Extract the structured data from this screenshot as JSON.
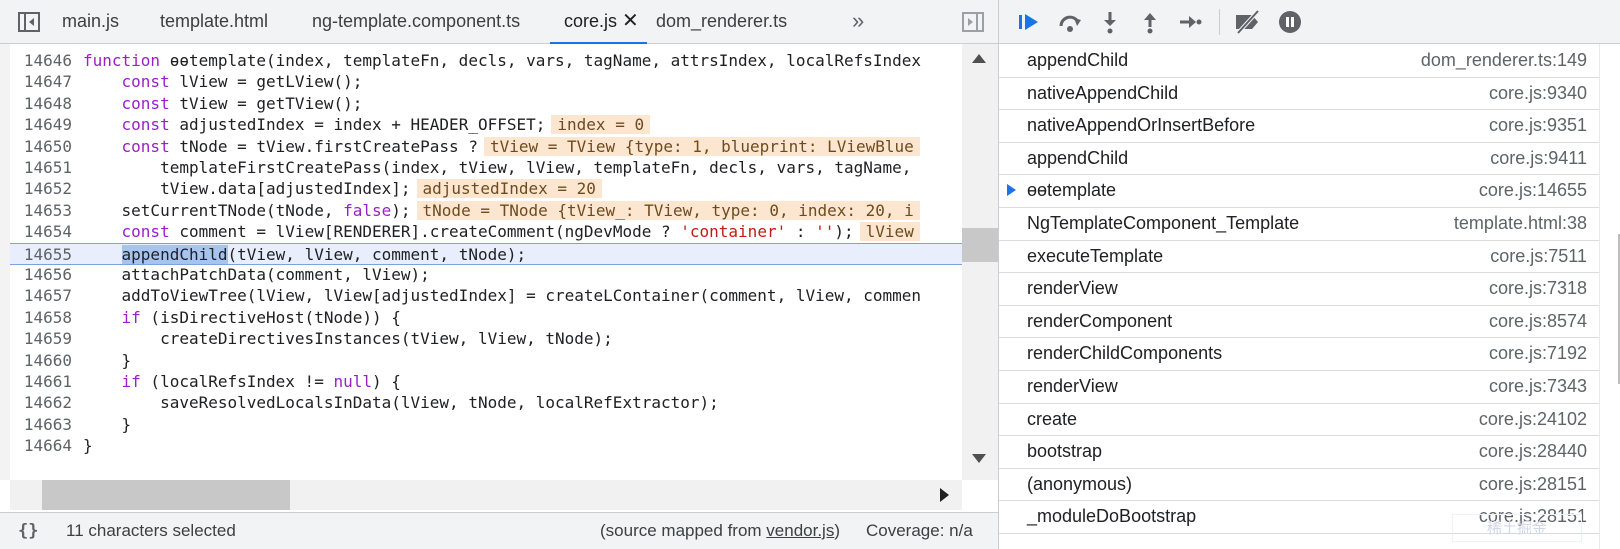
{
  "editor": {
    "tabs": [
      {
        "label": "main.js",
        "active": false
      },
      {
        "label": "template.html",
        "active": false
      },
      {
        "label": "ng-template.component.ts",
        "active": false
      },
      {
        "label": "core.js",
        "active": true
      },
      {
        "label": "dom_renderer.ts",
        "active": false
      }
    ],
    "tab_close_glyph": "✕",
    "more_tabs_glyph": "»",
    "current_line": 14655,
    "selected_text": "appendChild",
    "lines": [
      {
        "n": "14646",
        "code": "function ɵɵtemplate(index, templateFn, decls, vars, tagName, attrsIndex, localRefsIndex"
      },
      {
        "n": "14647",
        "code": "    const lView = getLView();"
      },
      {
        "n": "14648",
        "code": "    const tView = getTView();"
      },
      {
        "n": "14649",
        "code": "    const adjustedIndex = index + HEADER_OFFSET;",
        "inline": "index = 0"
      },
      {
        "n": "14650",
        "code": "    const tNode = tView.firstCreatePass ?",
        "inline": "tView = TView {type: 1, blueprint: LViewBlue"
      },
      {
        "n": "14651",
        "code": "        templateFirstCreatePass(index, tView, lView, templateFn, decls, vars, tagName,"
      },
      {
        "n": "14652",
        "code": "        tView.data[adjustedIndex];",
        "inline": "adjustedIndex = 20"
      },
      {
        "n": "14653",
        "code": "    setCurrentTNode(tNode, false);",
        "inline": "tNode = TNode {tView_: TView, type: 0, index: 20, i"
      },
      {
        "n": "14654",
        "code": "    const comment = lView[RENDERER].createComment(ngDevMode ? 'container' : '');",
        "inline": "lView"
      },
      {
        "n": "14655",
        "code": "    appendChild(tView, lView, comment, tNode);"
      },
      {
        "n": "14656",
        "code": "    attachPatchData(comment, lView);"
      },
      {
        "n": "14657",
        "code": "    addToViewTree(lView, lView[adjustedIndex] = createLContainer(comment, lView, commen"
      },
      {
        "n": "14658",
        "code": "    if (isDirectiveHost(tNode)) {"
      },
      {
        "n": "14659",
        "code": "        createDirectivesInstances(tView, lView, tNode);"
      },
      {
        "n": "14660",
        "code": "    }"
      },
      {
        "n": "14661",
        "code": "    if (localRefsIndex != null) {"
      },
      {
        "n": "14662",
        "code": "        saveResolvedLocalsInData(lView, tNode, localRefExtractor);"
      },
      {
        "n": "14663",
        "code": "    }"
      },
      {
        "n": "14664",
        "code": "}"
      }
    ],
    "status": {
      "pretty_print_glyph": "{}",
      "selection": "11 characters selected",
      "source_mapped_prefix": "(source mapped from ",
      "source_mapped_file": "vendor.js",
      "source_mapped_suffix": ")",
      "coverage": "Coverage: n/a"
    }
  },
  "debugger": {
    "toolbar_icons": [
      "resume-icon",
      "step-over-icon",
      "step-into-icon",
      "step-out-icon",
      "step-icon",
      "deactivate-breakpoints-icon",
      "pause-on-exceptions-icon"
    ],
    "call_stack": [
      {
        "name": "appendChild",
        "location": "dom_renderer.ts:149",
        "current": false
      },
      {
        "name": "nativeAppendChild",
        "location": "core.js:9340",
        "current": false
      },
      {
        "name": "nativeAppendOrInsertBefore",
        "location": "core.js:9351",
        "current": false
      },
      {
        "name": "appendChild",
        "location": "core.js:9411",
        "current": false
      },
      {
        "name": "ɵɵtemplate",
        "location": "core.js:14655",
        "current": true
      },
      {
        "name": "NgTemplateComponent_Template",
        "location": "template.html:38",
        "current": false
      },
      {
        "name": "executeTemplate",
        "location": "core.js:7511",
        "current": false
      },
      {
        "name": "renderView",
        "location": "core.js:7318",
        "current": false
      },
      {
        "name": "renderComponent",
        "location": "core.js:8574",
        "current": false
      },
      {
        "name": "renderChildComponents",
        "location": "core.js:7192",
        "current": false
      },
      {
        "name": "renderView",
        "location": "core.js:7343",
        "current": false
      },
      {
        "name": "create",
        "location": "core.js:24102",
        "current": false
      },
      {
        "name": "bootstrap",
        "location": "core.js:28440",
        "current": false
      },
      {
        "name": "(anonymous)",
        "location": "core.js:28151",
        "current": false
      },
      {
        "name": "_moduleDoBootstrap",
        "location": "core.js:28151",
        "current": false
      }
    ],
    "watermark": "稀土掘金"
  },
  "colors": {
    "accent": "#1a73e8",
    "keyword": "#9a1fc7",
    "string": "#c41a16",
    "inline_value_bg": "#fde6cf",
    "current_line_bg": "#e8eefb",
    "selection_bg": "#a7c4f0"
  }
}
